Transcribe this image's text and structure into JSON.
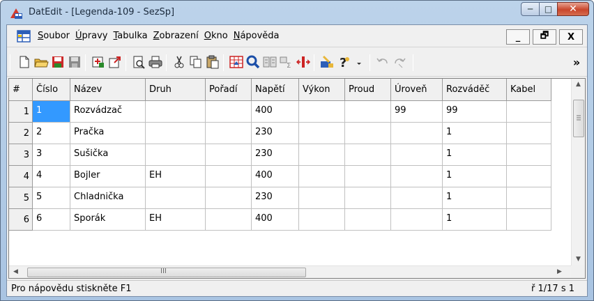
{
  "window": {
    "title": "DatEdit - [Legenda-109 - SezSp]"
  },
  "window_buttons": {
    "minimize": "─",
    "maximize": "□",
    "close": "✕"
  },
  "menu": [
    {
      "pre": "",
      "acc": "S",
      "post": "oubor"
    },
    {
      "pre": "",
      "acc": "Ú",
      "post": "pravy"
    },
    {
      "pre": "",
      "acc": "T",
      "post": "abulka"
    },
    {
      "pre": "",
      "acc": "Z",
      "post": "obrazení"
    },
    {
      "pre": "",
      "acc": "O",
      "post": "kno"
    },
    {
      "pre": "",
      "acc": "N",
      "post": "ápověda"
    }
  ],
  "mdi_buttons": {
    "minimize": "_",
    "restore": "🗗",
    "close": "X"
  },
  "toolbar_overflow": "»",
  "grid": {
    "corner": "#",
    "columns": [
      "Číslo",
      "Název",
      "Druh",
      "Pořadí",
      "Napětí",
      "Výkon",
      "Proud",
      "Úroveň",
      "Rozváděč",
      "Kabel"
    ],
    "row_headers": [
      "1",
      "2",
      "3",
      "4",
      "5",
      "6"
    ],
    "rows": [
      [
        "1",
        "Rozvádzač",
        "",
        "",
        "400",
        "",
        "",
        "99",
        "99",
        ""
      ],
      [
        "2",
        "Pračka",
        "",
        "",
        "230",
        "",
        "",
        "",
        "1",
        ""
      ],
      [
        "3",
        "Sušička",
        "",
        "",
        "230",
        "",
        "",
        "",
        "1",
        ""
      ],
      [
        "4",
        "Bojler",
        "EH",
        "",
        "400",
        "",
        "",
        "",
        "1",
        ""
      ],
      [
        "5",
        "Chladnička",
        "",
        "",
        "230",
        "",
        "",
        "",
        "1",
        ""
      ],
      [
        "6",
        "Sporák",
        "EH",
        "",
        "400",
        "",
        "",
        "",
        "1",
        ""
      ]
    ],
    "selected_cell": [
      0,
      0
    ]
  },
  "hscroll_grip": "III",
  "status": {
    "left": "Pro nápovědu stiskněte F1",
    "right": "ř 1/17 s 1"
  },
  "colors": {
    "selection": "#3399ff",
    "close_button": "#c9462c"
  }
}
